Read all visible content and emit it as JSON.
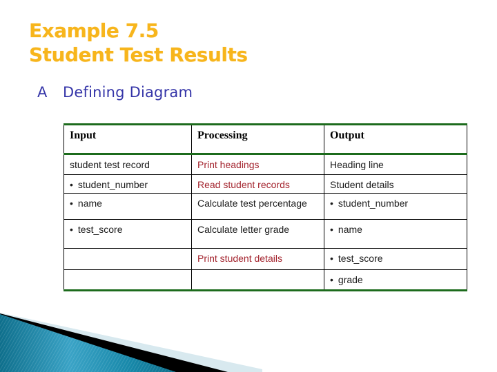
{
  "slide": {
    "title_line1": "Example 7.5",
    "title_line2": "Student Test Results",
    "section_marker": "A",
    "section_title": "Defining Diagram",
    "colors": {
      "title": "#f7b51c",
      "section": "#3535a8",
      "table_accent_border": "#1c6b1c",
      "highlight_text": "#a3232d"
    }
  },
  "table": {
    "headers": [
      "Input",
      "Processing",
      "Output"
    ],
    "rows": [
      {
        "input": "student test record",
        "input_bullet": false,
        "processing": "Print headings",
        "processing_highlight": true,
        "output": "Heading line",
        "output_bullet": false
      },
      {
        "input": "student_number",
        "input_bullet": true,
        "processing": "Read student records",
        "processing_highlight": true,
        "output": "Student details",
        "output_bullet": false
      },
      {
        "input": "name",
        "input_bullet": true,
        "processing": "Calculate test percentage",
        "processing_highlight": false,
        "output": "student_number",
        "output_bullet": true
      },
      {
        "input": "test_score",
        "input_bullet": true,
        "processing": "Calculate letter grade",
        "processing_highlight": false,
        "output": "name",
        "output_bullet": true
      },
      {
        "input": "",
        "input_bullet": false,
        "processing": "Print student details",
        "processing_highlight": true,
        "output": "test_score",
        "output_bullet": true
      },
      {
        "input": "",
        "input_bullet": false,
        "processing": "",
        "processing_highlight": false,
        "output": "grade",
        "output_bullet": true
      }
    ]
  }
}
